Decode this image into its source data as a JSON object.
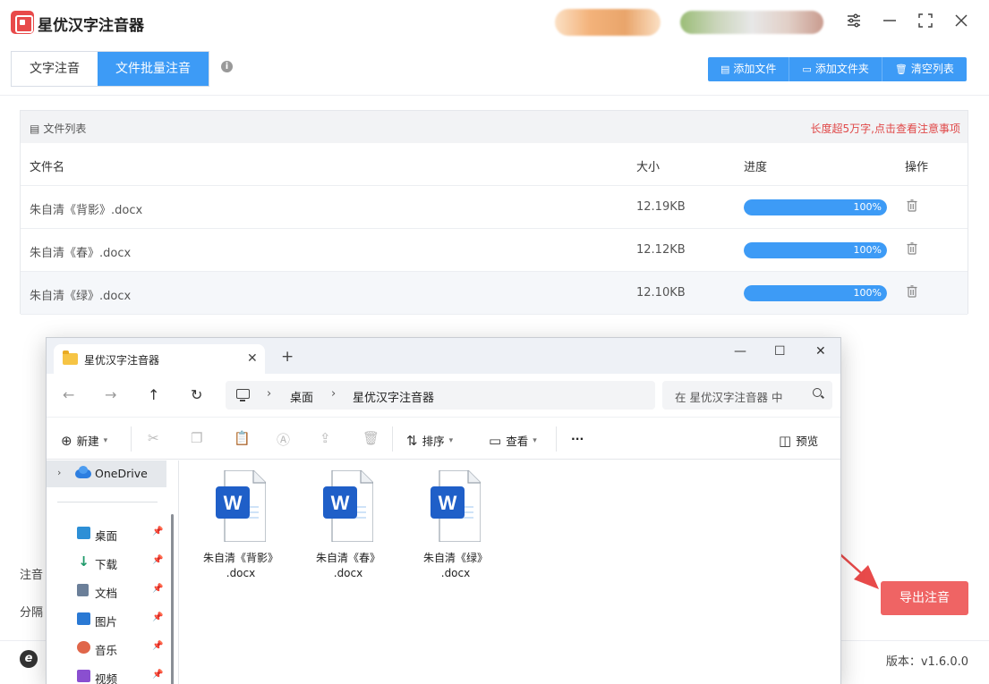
{
  "app": {
    "title": "星优汉字注音器"
  },
  "tabs": [
    {
      "label": "文字注音",
      "active": false
    },
    {
      "label": "文件批量注音",
      "active": true
    }
  ],
  "toolbar": {
    "add_file": "添加文件",
    "add_folder": "添加文件夹",
    "clear_list": "清空列表"
  },
  "file_list": {
    "title": "文件列表",
    "warning": "长度超5万字,点击查看注意事项",
    "columns": {
      "name": "文件名",
      "size": "大小",
      "progress": "进度",
      "action": "操作"
    },
    "rows": [
      {
        "name": "朱自清《背影》.docx",
        "size": "12.19KB",
        "progress": 1.0,
        "progress_label": "100%"
      },
      {
        "name": "朱自清《春》.docx",
        "size": "12.12KB",
        "progress": 1.0,
        "progress_label": "100%"
      },
      {
        "name": "朱自清《绿》.docx",
        "size": "12.10KB",
        "progress": 1.0,
        "progress_label": "100%"
      }
    ]
  },
  "options": {
    "label1": "注音",
    "label2": "分隔"
  },
  "export_button": "导出注音",
  "version": "版本：v1.6.0.0",
  "colors": {
    "accent": "#3d9bf6",
    "export": "#ef6464",
    "warning": "#e04848"
  },
  "explorer": {
    "tab_title": "星优汉字注音器",
    "breadcrumb": [
      "桌面",
      "星优汉字注音器"
    ],
    "search_placeholder": "在 星优汉字注音器 中",
    "commands": {
      "new": "新建",
      "sort": "排序",
      "view": "查看",
      "more": "···",
      "preview": "预览"
    },
    "sidebar": {
      "onedrive": "OneDrive",
      "items": [
        {
          "label": "桌面",
          "icon": "desktop-icon",
          "color": "#2d8fd6"
        },
        {
          "label": "下载",
          "icon": "download-icon",
          "color": "#1e9a6a"
        },
        {
          "label": "文档",
          "icon": "document-icon",
          "color": "#6b7f99"
        },
        {
          "label": "图片",
          "icon": "picture-icon",
          "color": "#2a79d4"
        },
        {
          "label": "音乐",
          "icon": "music-icon",
          "color": "#e0664a"
        },
        {
          "label": "视频",
          "icon": "video-icon",
          "color": "#8a4fd0"
        }
      ]
    },
    "files": [
      {
        "line1": "朱自清《背影》",
        "line2": ".docx"
      },
      {
        "line1": "朱自清《春》",
        "line2": ".docx"
      },
      {
        "line1": "朱自清《绿》",
        "line2": ".docx"
      }
    ]
  }
}
